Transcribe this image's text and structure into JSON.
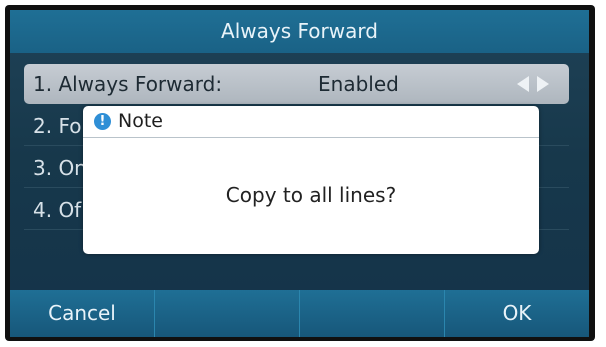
{
  "screen": {
    "title": "Always Forward"
  },
  "menu": {
    "items": [
      {
        "label": "1. Always Forward:",
        "value": "Enabled"
      },
      {
        "label": "2. Fo"
      },
      {
        "label": "3. On"
      },
      {
        "label": "4. Of"
      }
    ]
  },
  "dialog": {
    "title": "Note",
    "message": "Copy to all lines?"
  },
  "softkeys": {
    "left": "Cancel",
    "k2": "",
    "k3": "",
    "right": "OK"
  },
  "colors": {
    "title_bar": "#1a6286",
    "selected_row": "#aeb6be",
    "info_icon": "#2f8fd6"
  },
  "icons": [
    "info-icon",
    "left-arrow-icon",
    "right-arrow-icon"
  ]
}
